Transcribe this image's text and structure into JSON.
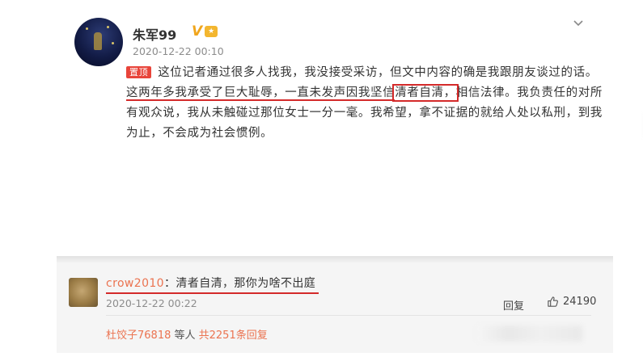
{
  "post": {
    "username": "朱军99",
    "verified_badge": "V",
    "level_badge_icon": "level-badge-icon",
    "time": "2020-12-22 00:10",
    "pin_tag": "置顶",
    "text": {
      "part1": "这位记者通过很多人找我，我没接受采访，但文中内容的确是我跟朋友谈过的话。",
      "underlined": "这两年多我承受了巨大耻辱，一直未发声因我坚信",
      "boxed": "清者自清",
      "boxed_punct": "，",
      "part2": "相信法律。我负责任的对所有观众说，我从未触碰过那位女士一分一毫。我希望，拿不证据的就给人处以私刑，到我为止，不会成为社会惯例。"
    }
  },
  "comment": {
    "username": "crow2010",
    "separator": "：",
    "text": "清者自清，那你为啥不出庭",
    "time": "2020-12-22 00:22",
    "reply_label": "回复",
    "likes": "24190",
    "replies_user": "杜饺子76818",
    "replies_mid": " 等人 ",
    "replies_count": "共2251条回复"
  },
  "colors": {
    "accent_red": "#d42a2a",
    "username_orange": "#eb7350",
    "pin_red": "#e8443a",
    "verified_gold": "#f0a51c"
  },
  "icons": {
    "menu": "chevron-down-icon",
    "like": "thumbs-up-icon"
  }
}
